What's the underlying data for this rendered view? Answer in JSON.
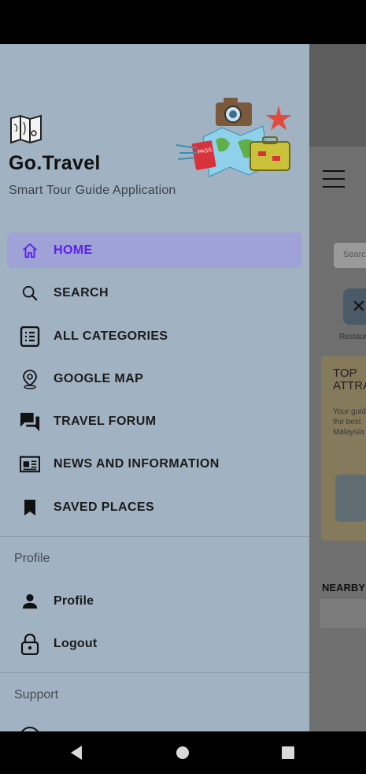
{
  "drawer": {
    "app_name": "Go.Travel",
    "app_subtitle": "Smart Tour Guide Application",
    "menu": [
      {
        "label": "HOME",
        "icon": "home-icon",
        "active": true
      },
      {
        "label": "SEARCH",
        "icon": "search-icon",
        "active": false
      },
      {
        "label": "ALL CATEGORIES",
        "icon": "list-icon",
        "active": false
      },
      {
        "label": "GOOGLE MAP",
        "icon": "map-pin-icon",
        "active": false
      },
      {
        "label": "TRAVEL FORUM",
        "icon": "forum-icon",
        "active": false
      },
      {
        "label": "NEWS AND INFORMATION",
        "icon": "news-icon",
        "active": false
      },
      {
        "label": "SAVED PLACES",
        "icon": "bookmark-icon",
        "active": false
      }
    ],
    "profile_section": {
      "title": "Profile",
      "items": [
        {
          "label": "Profile",
          "icon": "person-icon"
        },
        {
          "label": "Logout",
          "icon": "lock-icon"
        }
      ]
    },
    "support_section": {
      "title": "Support"
    }
  },
  "background_app": {
    "search_placeholder": "Search",
    "category_label": "Restaurants",
    "card_title": "TOP\nATTRACTIONS",
    "card_body": "Your guide\nthe best\nMalaysia",
    "nearby_title": "NEARBY"
  },
  "colors": {
    "drawer_bg": "#a1b2c2",
    "active_bg": "#9ea2d6",
    "active_text": "#5b21e6",
    "scrim": "#6f6f6f"
  }
}
